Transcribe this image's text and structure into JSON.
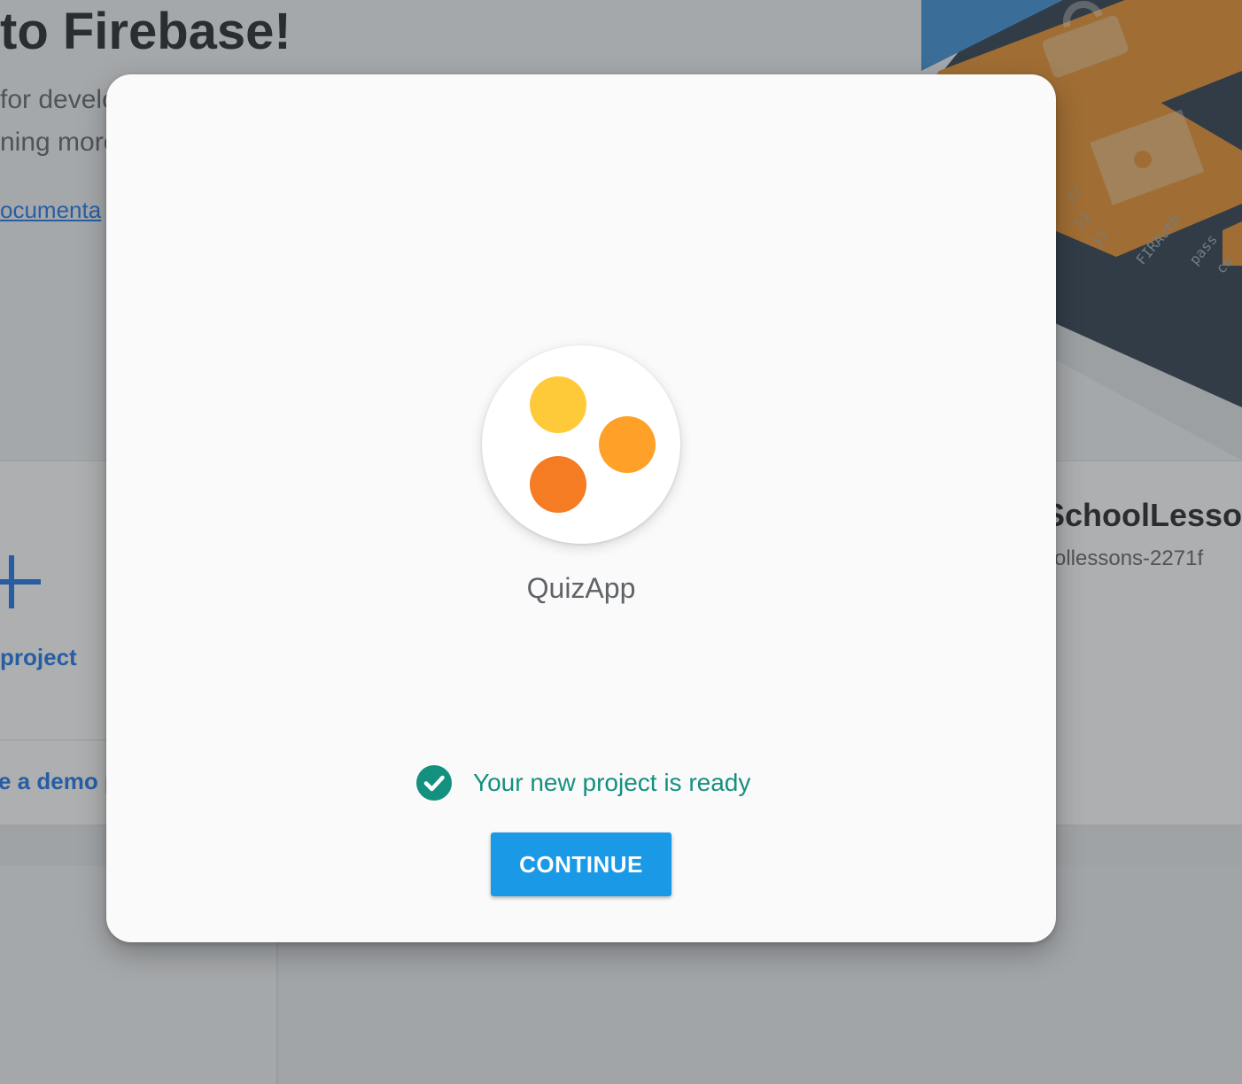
{
  "background": {
    "hero": {
      "title": "to Firebase!",
      "subtitle_line1": "for develo",
      "subtitle_line2": "ning more",
      "docs_link": "ocumenta"
    },
    "add_project": {
      "label": "project"
    },
    "demo_project": {
      "label": "e a demo p"
    },
    "existing_project": {
      "name": "SchoolLesso",
      "id": "ollessons-2271f"
    }
  },
  "dialog": {
    "project_name": "QuizApp",
    "logo_dot_colors": [
      "#FFCA3A",
      "#FFA028",
      "#F57C22"
    ],
    "status_text": "Your new project is ready",
    "status_icon": "check-circle-icon",
    "continue_label": "CONTINUE"
  },
  "colors": {
    "accent": "#1A9AE6",
    "success": "#14907F"
  }
}
